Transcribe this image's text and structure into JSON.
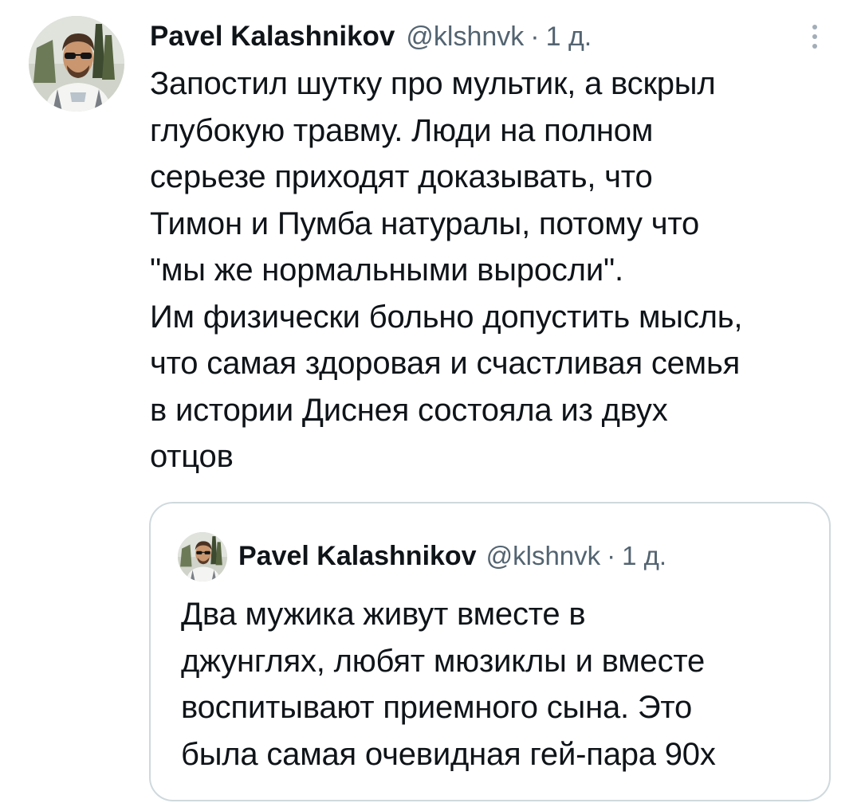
{
  "tweet": {
    "author_name": "Pavel Kalashnikov",
    "author_handle": "@klshnvk",
    "separator": "·",
    "time": "1 д.",
    "text_lines": [
      "Запостил шутку про мультик, а вскрыл",
      "глубокую травму. Люди на полном",
      "серьезе приходят доказывать, что",
      "Тимон и Пумба натуралы, потому что",
      "\"мы же нормальными выросли\".",
      "Им физически больно допустить мысль,",
      "что самая здоровая и счастливая семья",
      "в истории Диснея состояла из двух",
      "отцов"
    ],
    "more_icon": "more-vertical-icon"
  },
  "quoted_tweet": {
    "author_name": "Pavel Kalashnikov",
    "author_handle": "@klshnvk",
    "separator": "·",
    "time": "1 д.",
    "text_lines": [
      "Два мужика живут вместе в",
      "джунглях, любят мюзиклы и вместе",
      "воспитывают приемного сына. Это",
      "была самая очевидная гей-пара 90х"
    ]
  },
  "colors": {
    "text_primary": "#0f1419",
    "text_secondary": "#536471",
    "border": "#cfd9de",
    "background": "#ffffff"
  }
}
